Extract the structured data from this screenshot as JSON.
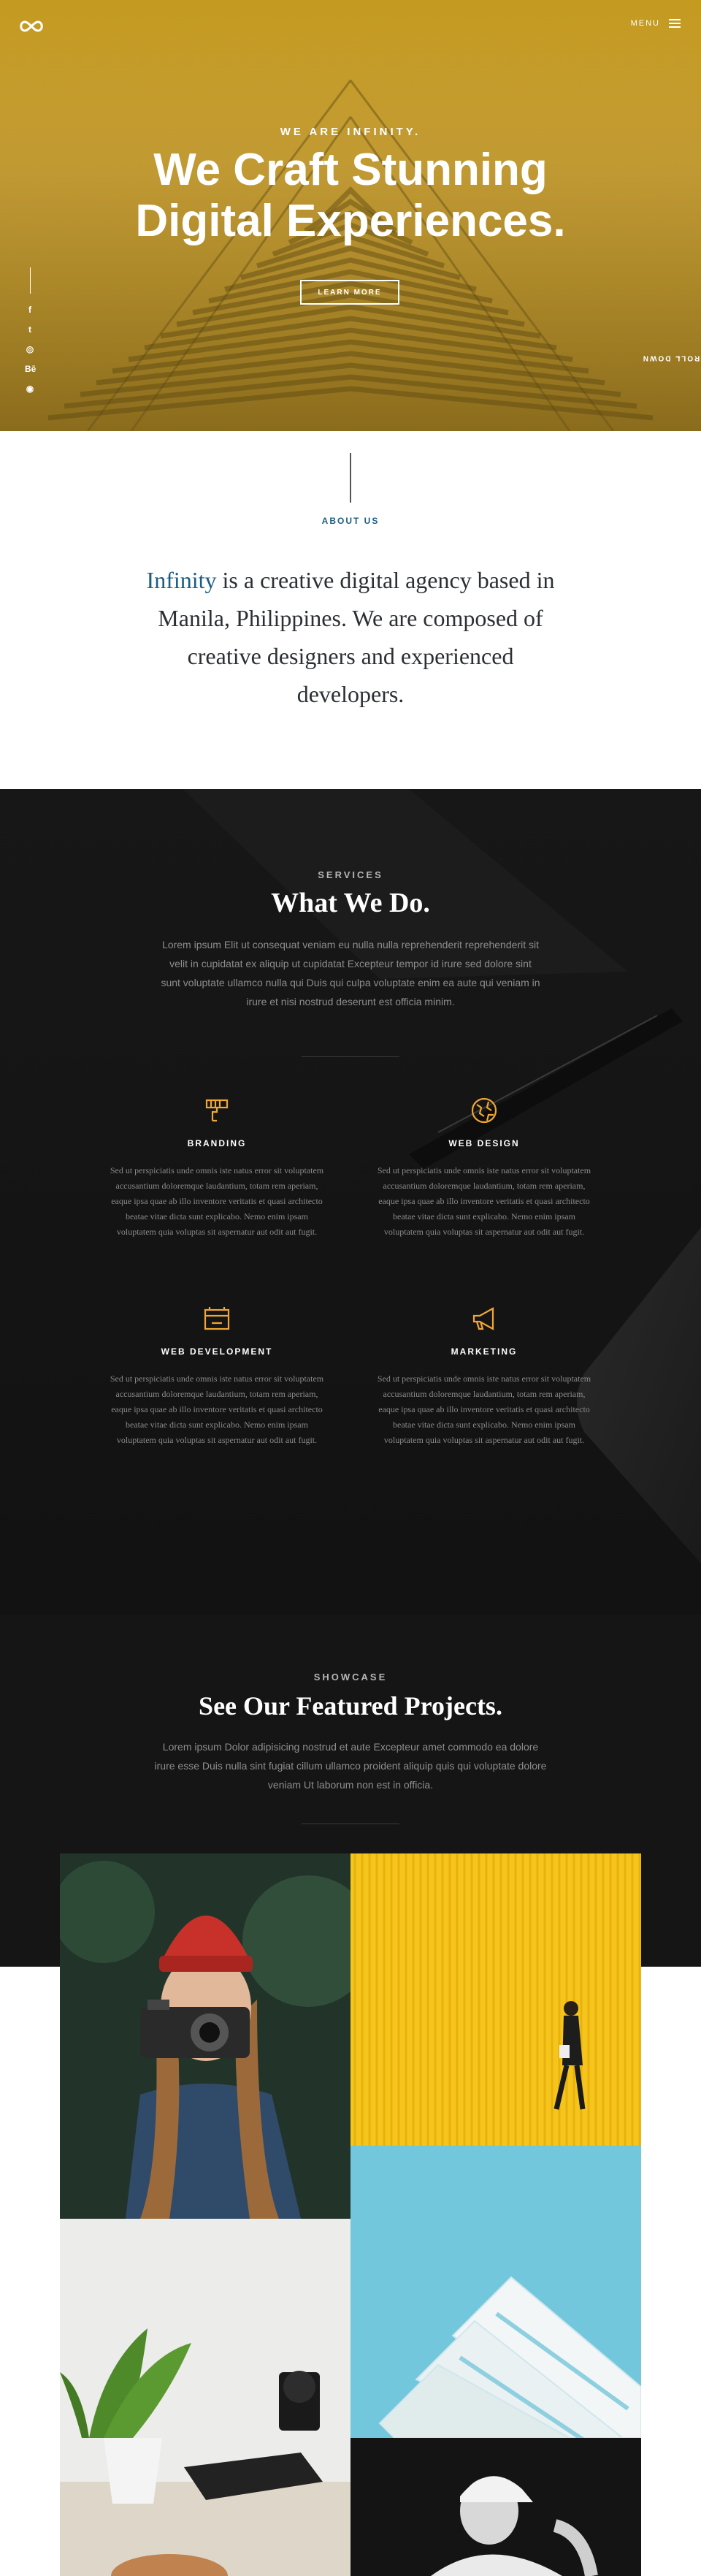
{
  "header": {
    "logo_icon": "infinity-logo-icon",
    "menu_label": "MENU"
  },
  "hero": {
    "kicker": "WE ARE INFINITY.",
    "title_line1": "We Craft Stunning",
    "title_line2": "Digital Experiences.",
    "button_label": "LEARN MORE",
    "scroll_label": "SCROLL DOWN",
    "scroll_arrow": "←",
    "social": [
      {
        "icon": "facebook-icon",
        "glyph": "f"
      },
      {
        "icon": "twitter-icon",
        "glyph": "t"
      },
      {
        "icon": "instagram-icon",
        "glyph": "◎"
      },
      {
        "icon": "behance-icon",
        "glyph": "Bē"
      },
      {
        "icon": "dribbble-icon",
        "glyph": "◉"
      }
    ],
    "colors": {
      "overlay": "#c49a20"
    }
  },
  "about": {
    "label": "ABOUT US",
    "accent": "Infinity",
    "text": " is a creative digital agency based in Manila, Philippines. We are composed of creative designers and experienced developers.",
    "colors": {
      "accent": "#1b5e83"
    }
  },
  "services": {
    "kicker": "SERVICES",
    "title": "What We Do.",
    "description": "Lorem ipsum Elit ut consequat veniam eu nulla nulla reprehenderit reprehenderit sit velit in cupidatat ex aliquip ut cupidatat Excepteur tempor id irure sed dolore sint sunt voluptate ullamco nulla qui Duis qui culpa voluptate enim ea aute qui veniam in irure et nisi nostrud deserunt est officia minim.",
    "items": [
      {
        "icon": "paint-brush-icon",
        "title": "BRANDING",
        "text": "Sed ut perspiciatis unde omnis iste natus error sit voluptatem accusantium doloremque laudantium, totam rem aperiam, eaque ipsa quae ab illo inventore veritatis et quasi architecto beatae vitae dicta sunt explicabo. Nemo enim ipsam voluptatem quia voluptas sit aspernatur aut odit aut fugit."
      },
      {
        "icon": "globe-icon",
        "title": "WEB DESIGN",
        "text": "Sed ut perspiciatis unde omnis iste natus error sit voluptatem accusantium doloremque laudantium, totam rem aperiam, eaque ipsa quae ab illo inventore veritatis et quasi architecto beatae vitae dicta sunt explicabo. Nemo enim ipsam voluptatem quia voluptas sit aspernatur aut odit aut fugit."
      },
      {
        "icon": "browser-window-icon",
        "title": "WEB DEVELOPMENT",
        "text": "Sed ut perspiciatis unde omnis iste natus error sit voluptatem accusantium doloremque laudantium, totam rem aperiam, eaque ipsa quae ab illo inventore veritatis et quasi architecto beatae vitae dicta sunt explicabo. Nemo enim ipsam voluptatem quia voluptas sit aspernatur aut odit aut fugit."
      },
      {
        "icon": "megaphone-icon",
        "title": "MARKETING",
        "text": "Sed ut perspiciatis unde omnis iste natus error sit voluptatem accusantium doloremque laudantium, totam rem aperiam, eaque ipsa quae ab illo inventore veritatis et quasi architecto beatae vitae dicta sunt explicabo. Nemo enim ipsam voluptatem quia voluptas sit aspernatur aut odit aut fugit."
      }
    ],
    "colors": {
      "icon": "#f0a733"
    }
  },
  "showcase": {
    "kicker": "SHOWCASE",
    "title": "See Our Featured Projects.",
    "description": "Lorem ipsum Dolor adipisicing nostrud et aute Excepteur amet commodo ea dolore irure esse Duis nulla sint fugiat cillum ullamco proident aliquip quis qui voluptate dolore veniam Ut laborum non est in officia.",
    "projects": [
      {
        "name": "photographer-with-camera"
      },
      {
        "name": "person-on-yellow-wall"
      },
      {
        "name": "plant-and-camera"
      },
      {
        "name": "architecture-on-blue"
      },
      {
        "name": "person-with-cap"
      }
    ]
  }
}
